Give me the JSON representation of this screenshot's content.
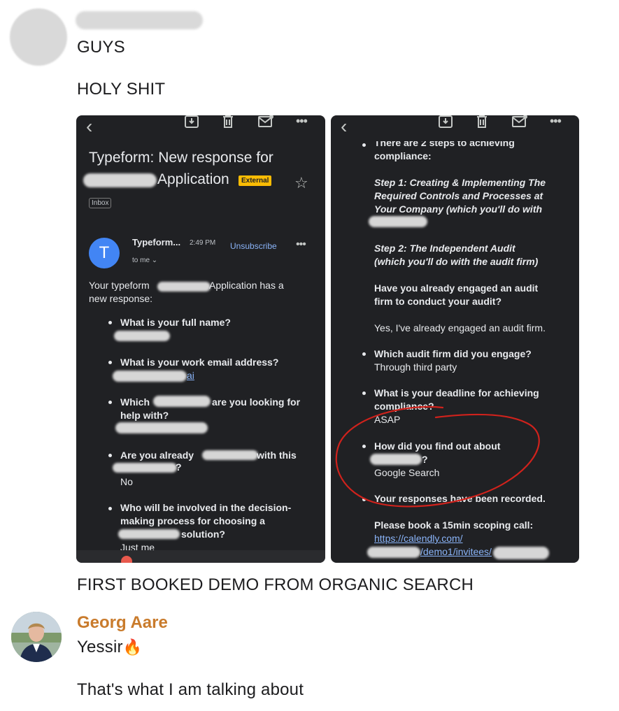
{
  "message1": {
    "lines": [
      "GUYS",
      "HOLY SHIT"
    ],
    "caption": "FIRST BOOKED DEMO FROM ORGANIC SEARCH"
  },
  "left_phone": {
    "subject_line1": "Typeform: New response for",
    "subject_line2": "Application",
    "external_badge": "External",
    "inbox_chip": "Inbox",
    "sender_initial": "T",
    "sender_name": "Typeform...",
    "time": "2:49 PM",
    "unsubscribe": "Unsubscribe",
    "to_me": "to me",
    "intro_a": "Your typeform",
    "intro_b": "Application has a",
    "intro_c": "new response:",
    "q1": "What is your full name?",
    "q2": "What is your work email address?",
    "q2_link": "ai",
    "q3_a": "Which",
    "q3_b": "are you looking for",
    "q3_c": "help with?",
    "q4_a": "Are you already",
    "q4_b": "with this",
    "q4_c": "?",
    "a4": "No",
    "q5_a": "Who will be involved in the decision-",
    "q5_b": "making process for choosing a",
    "q5_c": "solution?",
    "a5": "Just me"
  },
  "right_phone": {
    "top_cut": "There are 2 steps to achieving",
    "compliance": "compliance:",
    "step1_a": "Step 1: Creating & Implementing The",
    "step1_b": "Required Controls and Processes at",
    "step1_c": "Your Company (which you'll do with",
    "step2_a": "Step 2: The Independent Audit",
    "step2_b": "(which you'll do with the audit firm)",
    "q_engaged_a": "Have you already engaged an audit",
    "q_engaged_b": "firm to conduct your audit?",
    "a_engaged": "Yes, I've already engaged an audit firm.",
    "q_firm": "Which audit firm did you engage?",
    "a_firm": "Through third party",
    "q_deadline_a": "What is your deadline for achieving",
    "q_deadline_b": "compliance?",
    "a_deadline": "ASAP",
    "q_find_a": "How did you find out about",
    "q_find_b": "?",
    "a_find": "Google Search",
    "recorded": "Your responses have been recorded.",
    "book": "Please book a 15min scoping call:",
    "link1": "https://calendly.com/",
    "link2": "/demo1/invitees/",
    "annotation_color": "#d0221c"
  },
  "reply": {
    "name": "Georg Aare",
    "name_color": "#c97b2c",
    "line1": "Yessir",
    "emoji": "🔥",
    "line2": "That's what I am talking about"
  },
  "icons": [
    "back-icon",
    "archive-icon",
    "trash-icon",
    "mail-icon",
    "more-icon",
    "star-icon",
    "chevron-down-icon",
    "avatar"
  ]
}
